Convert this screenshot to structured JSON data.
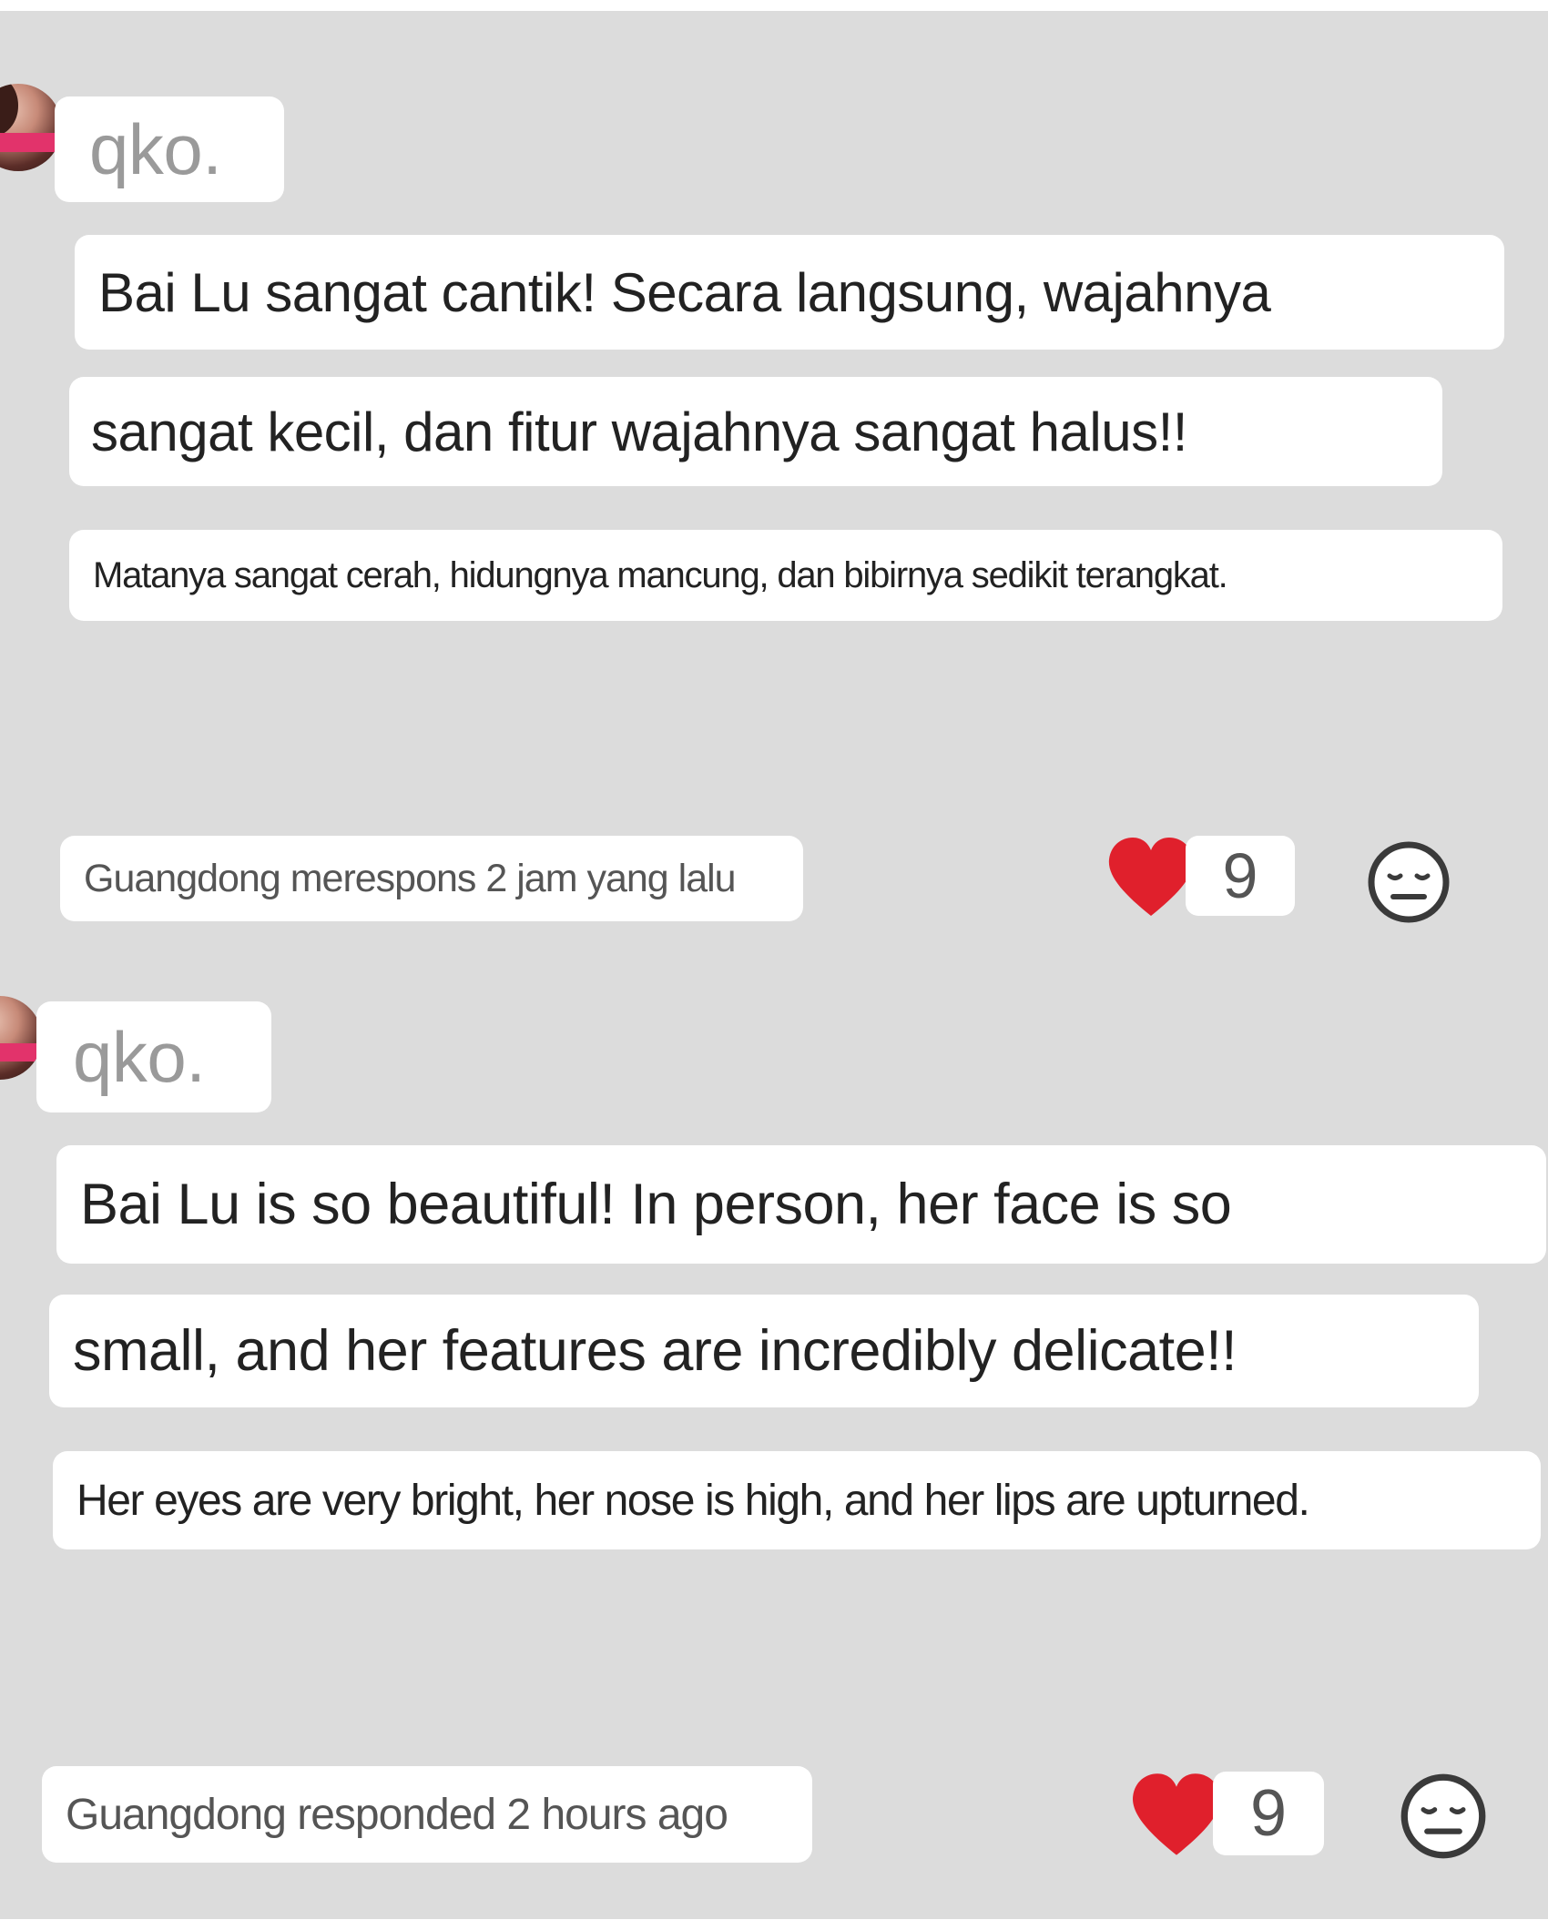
{
  "comments": [
    {
      "username": "qko.",
      "lines": [
        "Bai Lu sangat cantik! Secara langsung, wajahnya",
        "sangat kecil, dan fitur wajahnya sangat halus!!",
        "Matanya sangat cerah, hidungnya mancung, dan bibirnya sedikit terangkat."
      ],
      "meta": "Guangdong merespons 2 jam yang lalu",
      "likes": "9"
    },
    {
      "username": "qko.",
      "lines": [
        "Bai Lu is so beautiful! In person, her face is so",
        "small, and her features are incredibly delicate!!",
        "Her eyes are very bright, her nose is high, and her lips are upturned."
      ],
      "meta": "Guangdong responded 2 hours ago",
      "likes": "9"
    }
  ],
  "colors": {
    "background": "#dcdcdc",
    "bubble": "#ffffff",
    "heart": "#e0202c",
    "username": "#9a9a9a"
  },
  "icons": {
    "like": "heart-icon",
    "react": "neutral-face-icon"
  }
}
